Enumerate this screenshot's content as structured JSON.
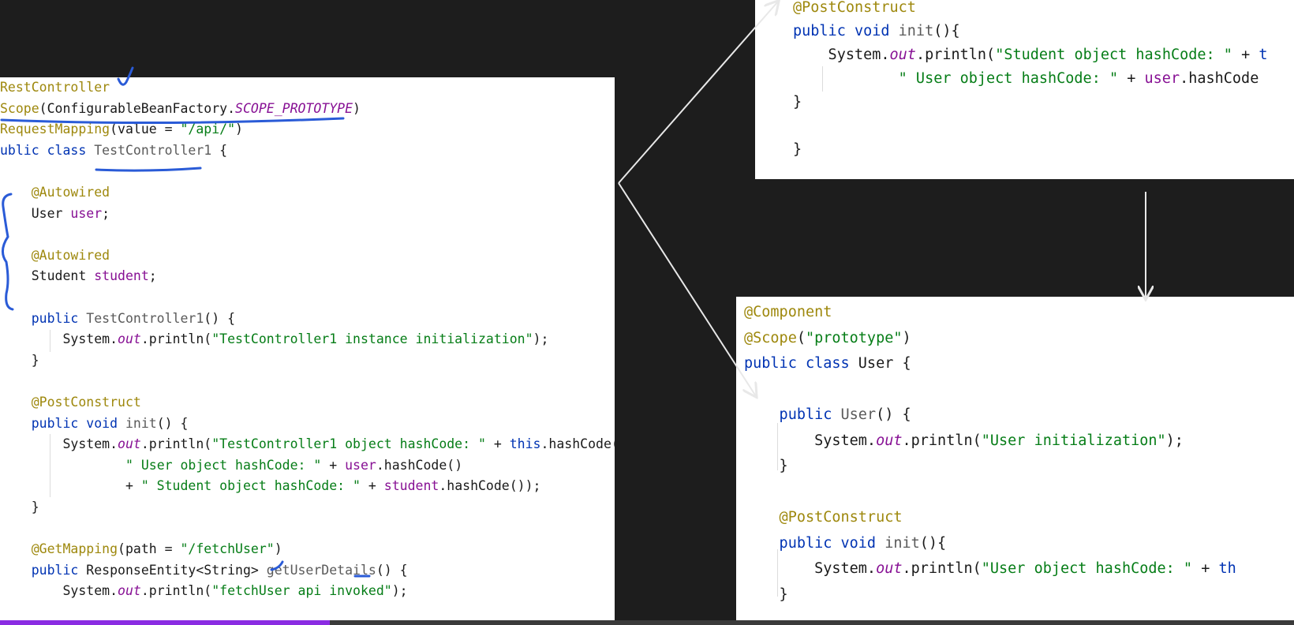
{
  "main_panel": {
    "lines": [
      {
        "segments": [
          {
            "t": "RestController",
            "c": "ann"
          }
        ]
      },
      {
        "segments": [
          {
            "t": "Scope",
            "c": "ann"
          },
          {
            "t": "(ConfigurableBeanFactory.",
            "c": ""
          },
          {
            "t": "SCOPE_PROTOTYPE",
            "c": "it"
          },
          {
            "t": ")",
            "c": ""
          }
        ]
      },
      {
        "segments": [
          {
            "t": "RequestMapping",
            "c": "ann"
          },
          {
            "t": "(value = ",
            "c": ""
          },
          {
            "t": "\"/api/\"",
            "c": "str"
          },
          {
            "t": ")",
            "c": ""
          }
        ]
      },
      {
        "segments": [
          {
            "t": "ublic class ",
            "c": "kw"
          },
          {
            "t": "TestController1",
            "c": "gray"
          },
          {
            "t": " {",
            "c": ""
          }
        ]
      },
      {
        "segments": []
      },
      {
        "segments": [
          {
            "t": "    @Autowired",
            "c": "ann"
          }
        ]
      },
      {
        "segments": [
          {
            "t": "    User ",
            "c": ""
          },
          {
            "t": "user",
            "c": "fld"
          },
          {
            "t": ";",
            "c": ""
          }
        ]
      },
      {
        "segments": []
      },
      {
        "segments": [
          {
            "t": "    @Autowired",
            "c": "ann"
          }
        ]
      },
      {
        "segments": [
          {
            "t": "    Student ",
            "c": ""
          },
          {
            "t": "student",
            "c": "fld"
          },
          {
            "t": ";",
            "c": ""
          }
        ]
      },
      {
        "segments": []
      },
      {
        "segments": [
          {
            "t": "    public ",
            "c": "kw"
          },
          {
            "t": "TestController1",
            "c": "gray"
          },
          {
            "t": "() {",
            "c": ""
          }
        ]
      },
      {
        "segments": [
          {
            "t": "        System.",
            "c": ""
          },
          {
            "t": "out",
            "c": "it"
          },
          {
            "t": ".println(",
            "c": ""
          },
          {
            "t": "\"TestController1 instance initialization\"",
            "c": "str"
          },
          {
            "t": ");",
            "c": ""
          }
        ]
      },
      {
        "segments": [
          {
            "t": "    }",
            "c": ""
          }
        ]
      },
      {
        "segments": []
      },
      {
        "segments": [
          {
            "t": "    @PostConstruct",
            "c": "ann"
          }
        ]
      },
      {
        "segments": [
          {
            "t": "    public void ",
            "c": "kw"
          },
          {
            "t": "init",
            "c": "gray"
          },
          {
            "t": "() {",
            "c": ""
          }
        ]
      },
      {
        "segments": [
          {
            "t": "        System.",
            "c": ""
          },
          {
            "t": "out",
            "c": "it"
          },
          {
            "t": ".println(",
            "c": ""
          },
          {
            "t": "\"TestController1 object hashCode: \"",
            "c": "str"
          },
          {
            "t": " + ",
            "c": ""
          },
          {
            "t": "this",
            "c": "kw"
          },
          {
            "t": ".hashCode() +",
            "c": ""
          }
        ]
      },
      {
        "segments": [
          {
            "t": "                ",
            "c": ""
          },
          {
            "t": "\" User object hashCode: \"",
            "c": "str"
          },
          {
            "t": " + ",
            "c": ""
          },
          {
            "t": "user",
            "c": "fld"
          },
          {
            "t": ".hashCode()",
            "c": ""
          }
        ]
      },
      {
        "segments": [
          {
            "t": "                + ",
            "c": ""
          },
          {
            "t": "\" Student object hashCode: \"",
            "c": "str"
          },
          {
            "t": " + ",
            "c": ""
          },
          {
            "t": "student",
            "c": "fld"
          },
          {
            "t": ".hashCode());",
            "c": ""
          }
        ]
      },
      {
        "segments": [
          {
            "t": "    }",
            "c": ""
          }
        ]
      },
      {
        "segments": []
      },
      {
        "segments": [
          {
            "t": "    @GetMapping",
            "c": "ann"
          },
          {
            "t": "(path = ",
            "c": ""
          },
          {
            "t": "\"/fetchUser\"",
            "c": "str"
          },
          {
            "t": ")",
            "c": ""
          }
        ]
      },
      {
        "segments": [
          {
            "t": "    public ",
            "c": "kw"
          },
          {
            "t": "ResponseEntity<String> ",
            "c": ""
          },
          {
            "t": "getUserDetails",
            "c": "gray"
          },
          {
            "t": "() {",
            "c": ""
          }
        ]
      },
      {
        "segments": [
          {
            "t": "        System.",
            "c": ""
          },
          {
            "t": "out",
            "c": "it"
          },
          {
            "t": ".println(",
            "c": ""
          },
          {
            "t": "\"fetchUser api invoked\"",
            "c": "str"
          },
          {
            "t": ");",
            "c": ""
          }
        ]
      }
    ]
  },
  "top_panel": {
    "lines": [
      {
        "segments": [
          {
            "t": "@PostConstruct",
            "c": "ann"
          }
        ]
      },
      {
        "segments": [
          {
            "t": "public void ",
            "c": "kw"
          },
          {
            "t": "init",
            "c": "gray"
          },
          {
            "t": "(){",
            "c": ""
          }
        ]
      },
      {
        "segments": [
          {
            "t": "    System.",
            "c": ""
          },
          {
            "t": "out",
            "c": "it"
          },
          {
            "t": ".println(",
            "c": ""
          },
          {
            "t": "\"Student object hashCode: \"",
            "c": "str"
          },
          {
            "t": " + ",
            "c": ""
          },
          {
            "t": "t",
            "c": "kw"
          }
        ]
      },
      {
        "segments": [
          {
            "t": "            ",
            "c": ""
          },
          {
            "t": "\" User object hashCode: \"",
            "c": "str"
          },
          {
            "t": " + ",
            "c": ""
          },
          {
            "t": "user",
            "c": "fld"
          },
          {
            "t": ".hashCode",
            "c": ""
          }
        ]
      },
      {
        "segments": [
          {
            "t": "}",
            "c": ""
          }
        ]
      },
      {
        "segments": []
      },
      {
        "segments": [
          {
            "t": "}",
            "c": ""
          }
        ]
      }
    ]
  },
  "user_panel": {
    "lines": [
      {
        "segments": [
          {
            "t": "@Component",
            "c": "ann"
          }
        ]
      },
      {
        "segments": [
          {
            "t": "@Scope",
            "c": "ann"
          },
          {
            "t": "(",
            "c": ""
          },
          {
            "t": "\"prototype\"",
            "c": "str"
          },
          {
            "t": ")",
            "c": ""
          }
        ]
      },
      {
        "segments": [
          {
            "t": "public class ",
            "c": "kw"
          },
          {
            "t": "User {",
            "c": ""
          }
        ]
      },
      {
        "segments": []
      },
      {
        "segments": [
          {
            "t": "    public ",
            "c": "kw"
          },
          {
            "t": "User",
            "c": "gray"
          },
          {
            "t": "() {",
            "c": ""
          }
        ]
      },
      {
        "segments": [
          {
            "t": "        System.",
            "c": ""
          },
          {
            "t": "out",
            "c": "it"
          },
          {
            "t": ".println(",
            "c": ""
          },
          {
            "t": "\"User initialization\"",
            "c": "str"
          },
          {
            "t": ");",
            "c": ""
          }
        ]
      },
      {
        "segments": [
          {
            "t": "    }",
            "c": ""
          }
        ]
      },
      {
        "segments": []
      },
      {
        "segments": [
          {
            "t": "    @PostConstruct",
            "c": "ann"
          }
        ]
      },
      {
        "segments": [
          {
            "t": "    public void ",
            "c": "kw"
          },
          {
            "t": "init",
            "c": "gray"
          },
          {
            "t": "(){",
            "c": ""
          }
        ]
      },
      {
        "segments": [
          {
            "t": "        System.",
            "c": ""
          },
          {
            "t": "out",
            "c": "it"
          },
          {
            "t": ".println(",
            "c": ""
          },
          {
            "t": "\"User object hashCode: \"",
            "c": "str"
          },
          {
            "t": " + ",
            "c": ""
          },
          {
            "t": "th",
            "c": "kw"
          }
        ]
      },
      {
        "segments": [
          {
            "t": "    }",
            "c": ""
          }
        ]
      }
    ]
  },
  "colors": {
    "annotation": "#9e880d",
    "keyword": "#0033b3",
    "string": "#067d17",
    "field": "#871094",
    "pen": "#2a5bd7",
    "arrow": "#e8e8e8",
    "progress": "#8a2be2"
  },
  "video": {
    "progress_fraction": 0.255
  }
}
